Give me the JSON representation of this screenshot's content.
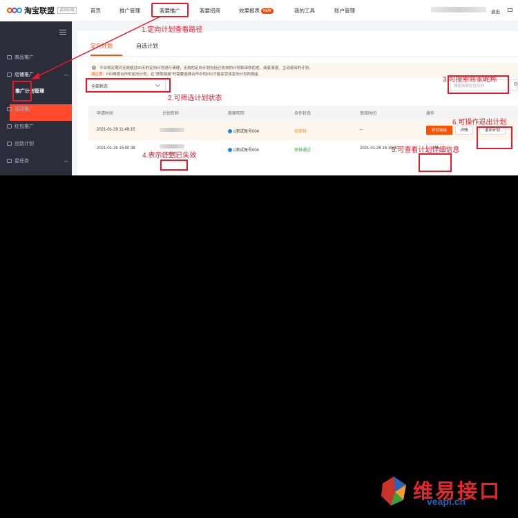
{
  "topnav": {
    "logo": "淘宝联盟",
    "logo_tag": "返回旧版",
    "items": [
      "首页",
      "推广管理",
      "我要推广",
      "我要招商",
      "效果报表",
      "我的工具",
      "账户管理"
    ],
    "new_badge": "NEW",
    "logout": "退出"
  },
  "sidebar": {
    "items": [
      "商品推广",
      "店铺推广",
      "推广计划管理",
      "活动推广",
      "红包推广",
      "丝路计划",
      "星任务"
    ]
  },
  "tabs": [
    "定向计划",
    "自选计划"
  ],
  "notice": {
    "line1": "平台将定期对无效超过90天的定向计划进行清理，无效的定向计划包括已失效的计划和审核拒绝、商家清退、主动退出的计划。",
    "line2_label": "请注意：",
    "line2": "PID维度合作的定向计划，在\"获取链接\"时需要选择合作中的PID才能享受该定向计划的佣金"
  },
  "filter": {
    "status_value": "全部状态"
  },
  "search": {
    "placeholder": "搜索商家旺旺名称"
  },
  "table": {
    "headers": [
      "申请时间",
      "计划名称",
      "商家旺旺",
      "合作状态",
      "审核时间",
      "操作"
    ],
    "rows": [
      {
        "apply_time": "2021-01-29 11:49:15",
        "merchant": "c测试账号004",
        "status": "待审核",
        "review_time": "--",
        "actions": [
          "获取链接",
          "详情",
          "退出计划"
        ]
      },
      {
        "apply_time": "2021-01-26 15:00:38",
        "tag": "已失效",
        "merchant": "c测试账号004",
        "status": "审核通过",
        "review_time": "2021-01-26 15:19:30",
        "actions": [
          "详情"
        ]
      }
    ]
  },
  "annotations": {
    "a1": "1.定向计划查看路径",
    "a2": "2.可筛选计划状态",
    "a3": "3.可搜索商家昵称",
    "a4": "4.表示计划已失效",
    "a5": "5.可查看计划详细信息",
    "a6": "6.可操作退出计划"
  },
  "watermark": {
    "cn": "维易接口",
    "en": "veapi.cn"
  },
  "colors": {
    "accent": "#ff5000",
    "annotation": "#e8192c",
    "sidebar_bg": "#2b2d3b"
  }
}
